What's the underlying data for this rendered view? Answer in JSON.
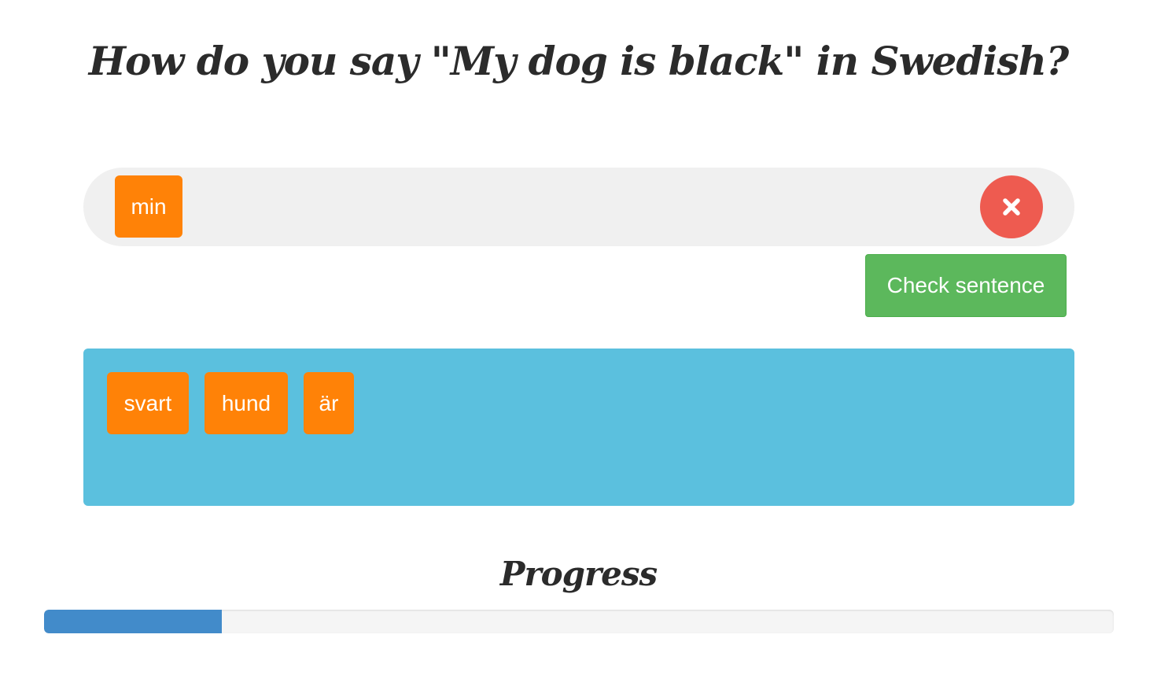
{
  "question": {
    "text": "How do you say \"My dog is black\" in Swedish?"
  },
  "answer": {
    "selected_words": [
      "min"
    ],
    "clear_icon": "close-icon"
  },
  "check_button": {
    "label": "Check sentence"
  },
  "word_bank": {
    "words": [
      "svart",
      "hund",
      "är"
    ]
  },
  "progress": {
    "title": "Progress",
    "value_fraction": 0.166
  },
  "colors": {
    "word_chip": "#ff8207",
    "word_bank_bg": "#5bc0de",
    "clear_button": "#ee5b50",
    "check_button": "#5cb85c",
    "progress_fill": "#428bca"
  }
}
